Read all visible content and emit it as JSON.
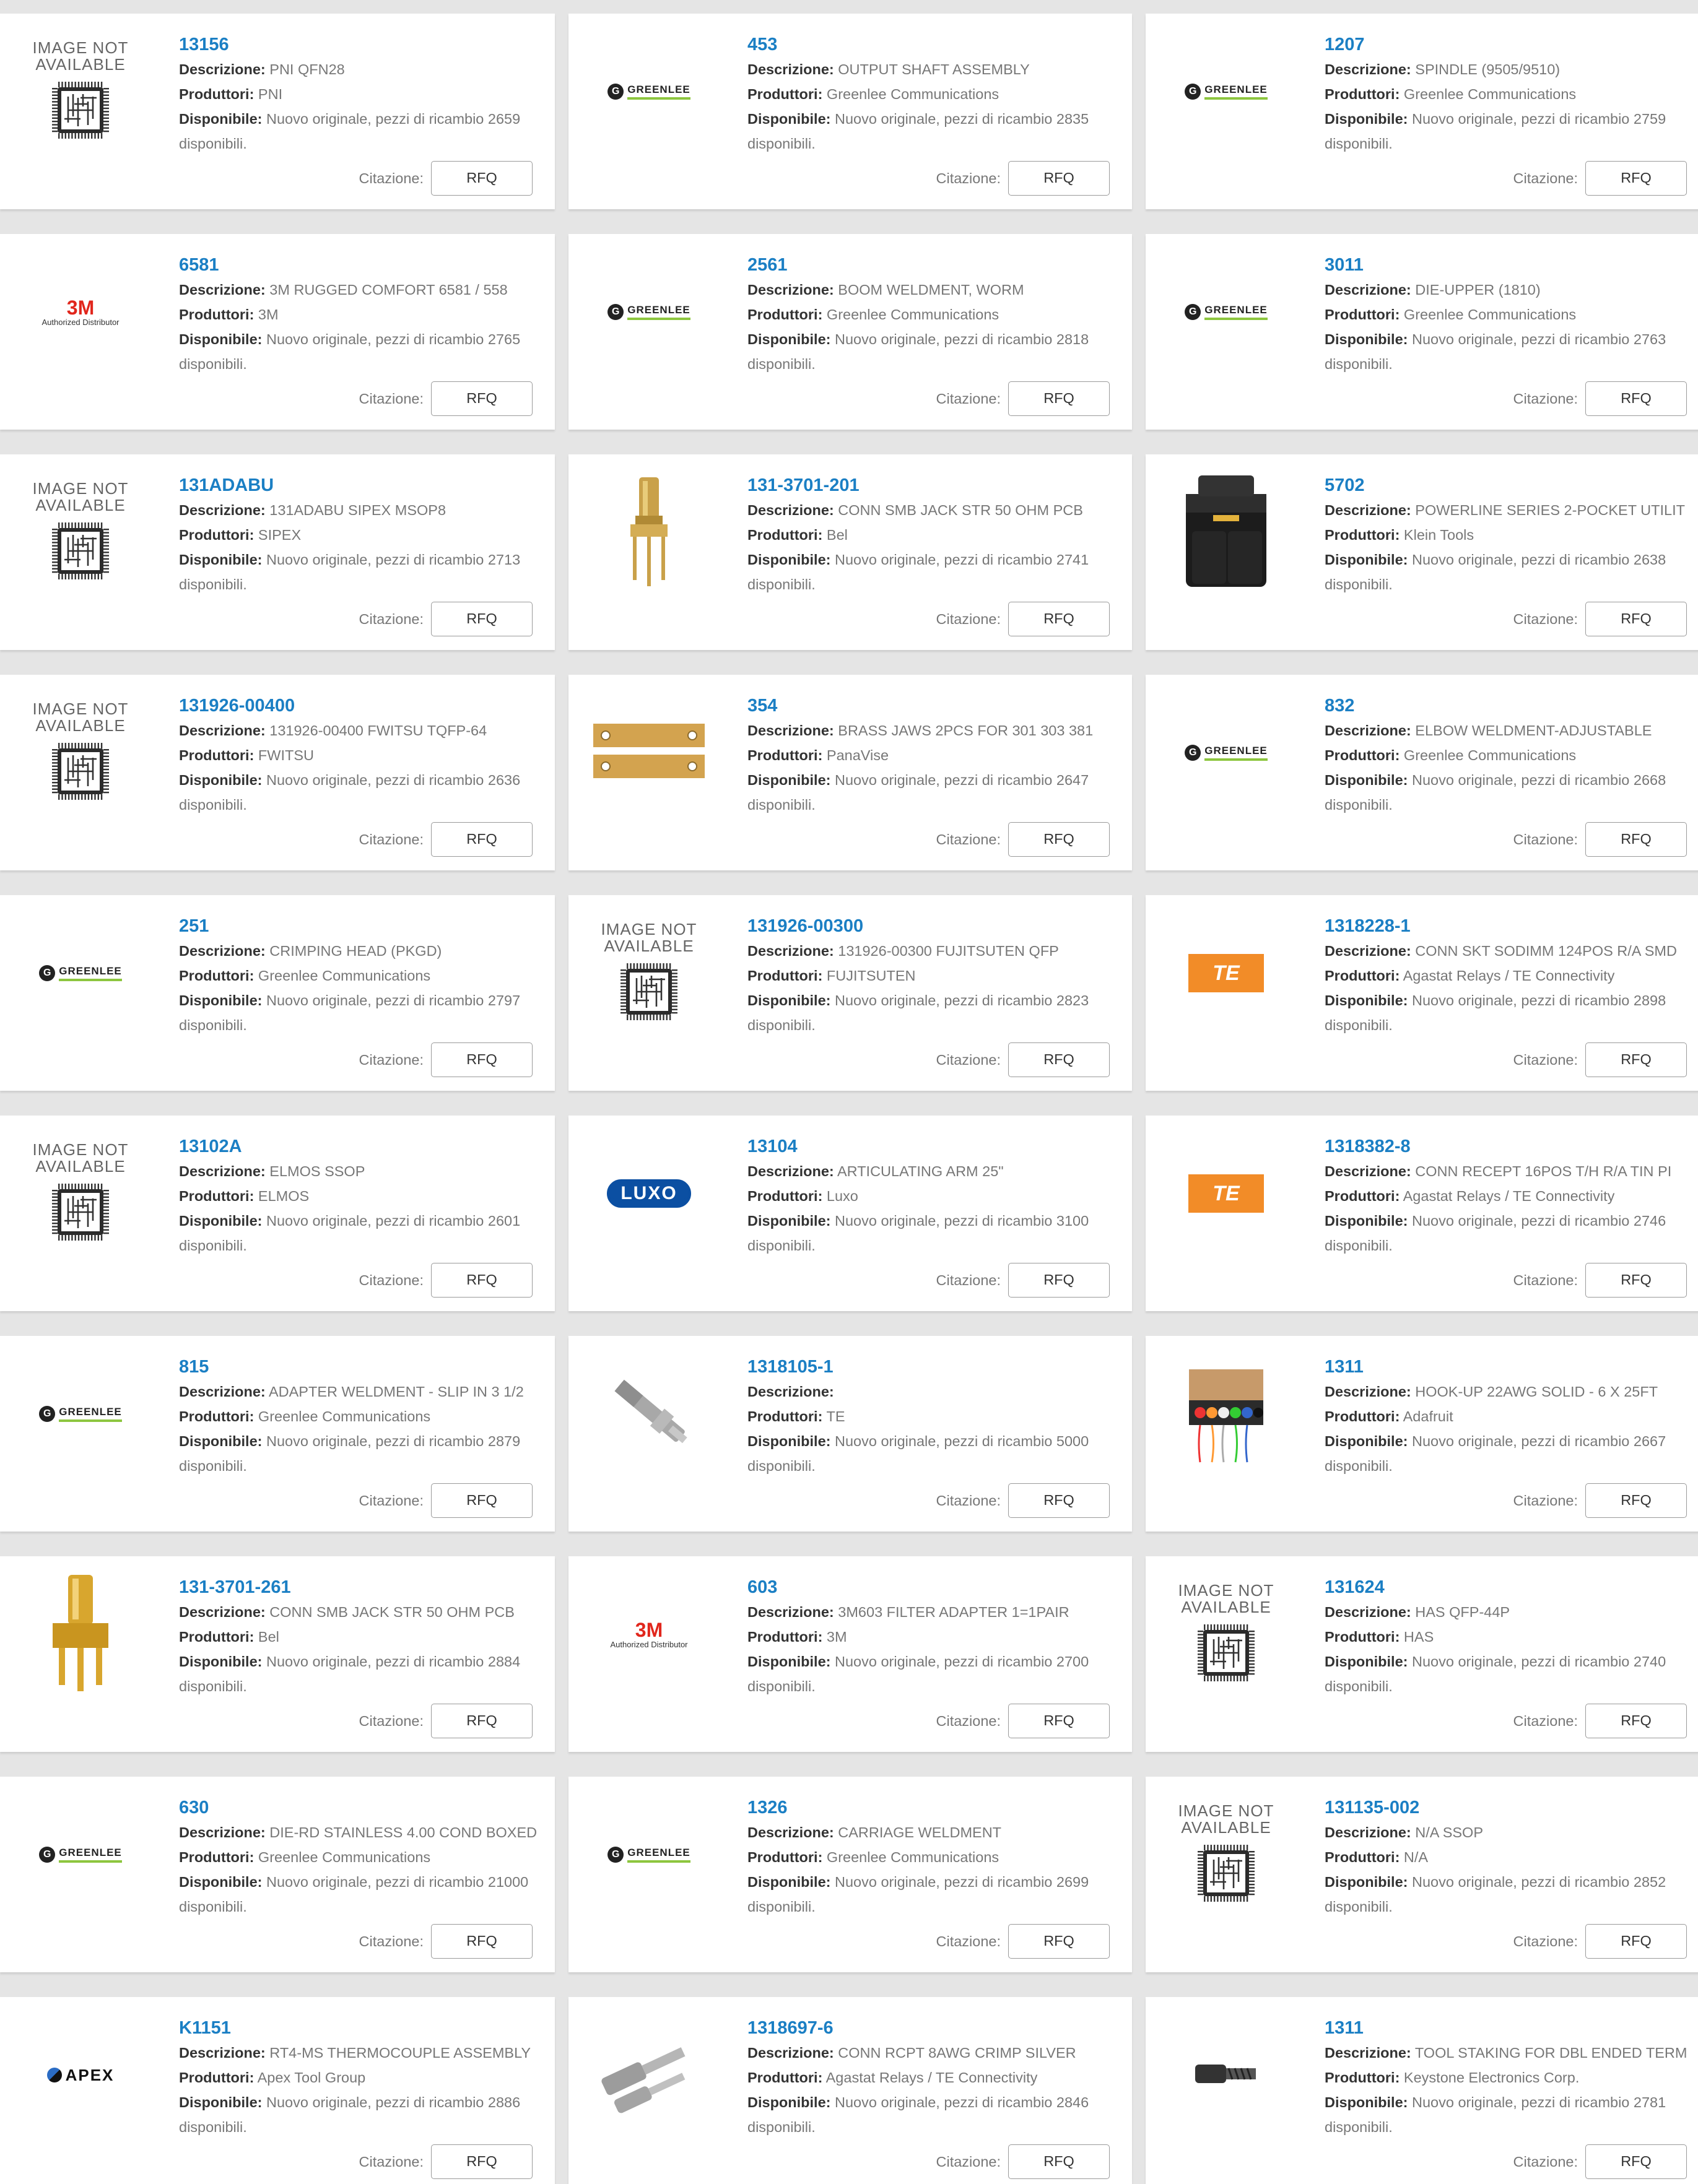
{
  "labels": {
    "description": "Descrizione:",
    "manufacturer": "Produttori:",
    "available": "Disponibile:",
    "quote": "Citazione:",
    "rfq": "RFQ"
  },
  "image_not_available": [
    "IMAGE NOT",
    "AVAILABLE"
  ],
  "products": [
    {
      "pn": "13156",
      "desc": "PNI QFN28",
      "mfr": "PNI",
      "avail": "Nuovo originale, pezzi di ricambio 2659 disponibili.",
      "image": "image-not-available"
    },
    {
      "pn": "453",
      "desc": "OUTPUT SHAFT ASSEMBLY",
      "mfr": "Greenlee Communications",
      "avail": "Nuovo originale, pezzi di ricambio 2835 disponibili.",
      "image": "greenlee-logo"
    },
    {
      "pn": "1207",
      "desc": "SPINDLE (9505/9510)",
      "mfr": "Greenlee Communications",
      "avail": "Nuovo originale, pezzi di ricambio 2759 disponibili.",
      "image": "greenlee-logo"
    },
    {
      "pn": "6581",
      "desc": "3M RUGGED COMFORT 6581 / 558",
      "mfr": "3M",
      "avail": "Nuovo originale, pezzi di ricambio 2765 disponibili.",
      "image": "3m-logo"
    },
    {
      "pn": "2561",
      "desc": "BOOM WELDMENT, WORM",
      "mfr": "Greenlee Communications",
      "avail": "Nuovo originale, pezzi di ricambio 2818 disponibili.",
      "image": "greenlee-logo"
    },
    {
      "pn": "3011",
      "desc": "DIE-UPPER (1810)",
      "mfr": "Greenlee Communications",
      "avail": "Nuovo originale, pezzi di ricambio 2763 disponibili.",
      "image": "greenlee-logo"
    },
    {
      "pn": "131ADABU",
      "desc": "131ADABU SIPEX MSOP8",
      "mfr": "SIPEX",
      "avail": "Nuovo originale, pezzi di ricambio 2713 disponibili.",
      "image": "image-not-available"
    },
    {
      "pn": "131-3701-201",
      "desc": "CONN SMB JACK STR 50 OHM PCB",
      "mfr": "Bel",
      "avail": "Nuovo originale, pezzi di ricambio 2741 disponibili.",
      "image": "smb-jack-photo"
    },
    {
      "pn": "5702",
      "desc": "POWERLINE SERIES 2-POCKET UTILIT",
      "mfr": "Klein Tools",
      "avail": "Nuovo originale, pezzi di ricambio 2638 disponibili.",
      "image": "tool-pouch-photo"
    },
    {
      "pn": "131926-00400",
      "desc": "131926-00400 FWITSU TQFP-64",
      "mfr": "FWITSU",
      "avail": "Nuovo originale, pezzi di ricambio 2636 disponibili.",
      "image": "image-not-available"
    },
    {
      "pn": "354",
      "desc": "BRASS JAWS 2PCS FOR 301 303 381",
      "mfr": "PanaVise",
      "avail": "Nuovo originale, pezzi di ricambio 2647 disponibili.",
      "image": "brass-jaws-photo"
    },
    {
      "pn": "832",
      "desc": "ELBOW WELDMENT-ADJUSTABLE",
      "mfr": "Greenlee Communications",
      "avail": "Nuovo originale, pezzi di ricambio 2668 disponibili.",
      "image": "greenlee-logo"
    },
    {
      "pn": "251",
      "desc": "CRIMPING HEAD (PKGD)",
      "mfr": "Greenlee Communications",
      "avail": "Nuovo originale, pezzi di ricambio 2797 disponibili.",
      "image": "greenlee-logo"
    },
    {
      "pn": "131926-00300",
      "desc": "131926-00300 FUJITSUTEN QFP",
      "mfr": "FUJITSUTEN",
      "avail": "Nuovo originale, pezzi di ricambio 2823 disponibili.",
      "image": "image-not-available"
    },
    {
      "pn": "1318228-1",
      "desc": "CONN SKT SODIMM 124POS R/A SMD",
      "mfr": "Agastat Relays / TE Connectivity",
      "avail": "Nuovo originale, pezzi di ricambio 2898 disponibili.",
      "image": "te-logo"
    },
    {
      "pn": "13102A",
      "desc": "ELMOS SSOP",
      "mfr": "ELMOS",
      "avail": "Nuovo originale, pezzi di ricambio 2601 disponibili.",
      "image": "image-not-available"
    },
    {
      "pn": "13104",
      "desc": "ARTICULATING ARM 25\"",
      "mfr": "Luxo",
      "avail": "Nuovo originale, pezzi di ricambio 3100 disponibili.",
      "image": "luxo-logo"
    },
    {
      "pn": "1318382-8",
      "desc": "CONN RECEPT 16POS T/H R/A TIN PI",
      "mfr": "Agastat Relays / TE Connectivity",
      "avail": "Nuovo originale, pezzi di ricambio 2746 disponibili.",
      "image": "te-logo"
    },
    {
      "pn": "815",
      "desc": "ADAPTER WELDMENT - SLIP IN 3 1/2",
      "mfr": "Greenlee Communications",
      "avail": "Nuovo originale, pezzi di ricambio 2879 disponibili.",
      "image": "greenlee-logo"
    },
    {
      "pn": "1318105-1",
      "desc": "",
      "mfr": "TE",
      "avail": "Nuovo originale, pezzi di ricambio 5000 disponibili.",
      "image": "crimp-terminal-photo"
    },
    {
      "pn": "1311",
      "desc": "HOOK-UP 22AWG SOLID - 6 X 25FT",
      "mfr": "Adafruit",
      "avail": "Nuovo originale, pezzi di ricambio 2667 disponibili.",
      "image": "wire-spools-photo"
    },
    {
      "pn": "131-3701-261",
      "desc": "CONN SMB JACK STR 50 OHM PCB",
      "mfr": "Bel",
      "avail": "Nuovo originale, pezzi di ricambio 2884 disponibili.",
      "image": "smb-jack-gold-photo"
    },
    {
      "pn": "603",
      "desc": "3M603 FILTER ADAPTER 1=1PAIR",
      "mfr": "3M",
      "avail": "Nuovo originale, pezzi di ricambio 2700 disponibili.",
      "image": "3m-logo"
    },
    {
      "pn": "131624",
      "desc": "HAS QFP-44P",
      "mfr": "HAS",
      "avail": "Nuovo originale, pezzi di ricambio 2740 disponibili.",
      "image": "image-not-available"
    },
    {
      "pn": "630",
      "desc": "DIE-RD STAINLESS 4.00 COND BOXED",
      "mfr": "Greenlee Communications",
      "avail": "Nuovo originale, pezzi di ricambio 21000 disponibili.",
      "image": "greenlee-logo"
    },
    {
      "pn": "1326",
      "desc": "CARRIAGE WELDMENT",
      "mfr": "Greenlee Communications",
      "avail": "Nuovo originale, pezzi di ricambio 2699 disponibili.",
      "image": "greenlee-logo"
    },
    {
      "pn": "131135-002",
      "desc": "N/A SSOP",
      "mfr": "N/A",
      "avail": "Nuovo originale, pezzi di ricambio 2852 disponibili.",
      "image": "image-not-available"
    },
    {
      "pn": "K1151",
      "desc": "RT4-MS THERMOCOUPLE ASSEMBLY",
      "mfr": "Apex Tool Group",
      "avail": "Nuovo originale, pezzi di ricambio 2886 disponibili.",
      "image": "apex-logo"
    },
    {
      "pn": "1318697-6",
      "desc": "CONN RCPT 8AWG CRIMP SILVER",
      "mfr": "Agastat Relays / TE Connectivity",
      "avail": "Nuovo originale, pezzi di ricambio 2846 disponibili.",
      "image": "crimp-receptacle-photo"
    },
    {
      "pn": "1311",
      "desc": "TOOL STAKING FOR DBL ENDED TERM",
      "mfr": "Keystone Electronics Corp.",
      "avail": "Nuovo originale, pezzi di ricambio 2781 disponibili.",
      "image": "staking-tool-photo"
    }
  ],
  "logos": {
    "greenlee": "GREENLEE",
    "greenlee_mark": "G",
    "three_m": "3M",
    "three_m_sub": "Authorized Distributor",
    "te": "TE",
    "luxo": "LUXO",
    "apex": "APEX"
  },
  "colors": {
    "link": "#1b7fc4",
    "page_bg": "#e5e5e5",
    "card_bg": "#ffffff",
    "greenlee_green": "#8dc63f",
    "te_orange": "#f28c28",
    "three_m_red": "#e1261c",
    "luxo_blue": "#0b4fa2"
  }
}
